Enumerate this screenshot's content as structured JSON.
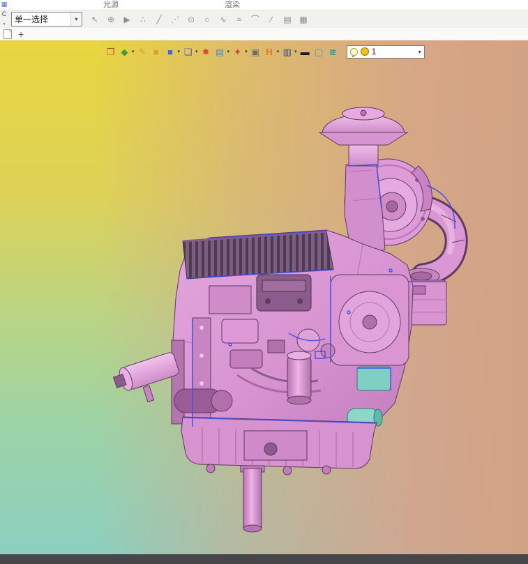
{
  "ribbon": {
    "group_labels": [
      "光源",
      "渲染"
    ]
  },
  "edge_icons": [
    {
      "name": "window-grid-icon",
      "glyph": "▦",
      "color": "#4a6fd0"
    },
    {
      "name": "clip-icon",
      "glyph": "C",
      "color": "#444444"
    },
    {
      "name": "pin-icon",
      "glyph": "▪",
      "color": "#888888"
    }
  ],
  "selection_toolbar": {
    "mode_value": "单一选择",
    "icons": [
      {
        "name": "select-cursor-icon",
        "glyph": "↖"
      },
      {
        "name": "rotate-select-icon",
        "glyph": "⊕"
      },
      {
        "name": "play-icon",
        "glyph": "▶"
      },
      {
        "name": "point-snap-icon",
        "glyph": "∴"
      },
      {
        "name": "line-icon",
        "glyph": "╱"
      },
      {
        "name": "polyline-icon",
        "glyph": "⋰"
      },
      {
        "name": "circle-point-icon",
        "glyph": "⊙"
      },
      {
        "name": "circle-icon",
        "glyph": "○"
      },
      {
        "name": "spline-icon",
        "glyph": "∿"
      },
      {
        "name": "wave-curve-icon",
        "glyph": "≈"
      },
      {
        "name": "arc-icon",
        "glyph": "⌒"
      },
      {
        "name": "segment-icon",
        "glyph": "∕"
      },
      {
        "name": "sheet-icon",
        "glyph": "▤"
      },
      {
        "name": "layers-sheet-icon",
        "glyph": "▦"
      }
    ]
  },
  "tab_bar": {
    "new_tab": "+"
  },
  "render_toolbar": {
    "icons": [
      {
        "name": "render-window-icon",
        "glyph": "❐",
        "color": "#b04a3a"
      },
      {
        "name": "material-apply-icon",
        "glyph": "◆",
        "color": "#3f9b3f",
        "dropdown": true
      },
      {
        "name": "paintbrush-icon",
        "glyph": "✎",
        "color": "#c9a227"
      },
      {
        "name": "cube-yellow-icon",
        "glyph": "■",
        "color": "#d8a427"
      },
      {
        "name": "cube-blue-icon",
        "glyph": "■",
        "color": "#3f6fd8",
        "dropdown": true
      },
      {
        "name": "cube-stack-icon",
        "glyph": "❏",
        "color": "#5a4fd8",
        "dropdown": true
      },
      {
        "name": "material-ball-icon",
        "glyph": "✹",
        "color": "#d84a2f"
      },
      {
        "name": "texture-image-icon",
        "glyph": "▤",
        "color": "#3f8fd8",
        "dropdown": true
      },
      {
        "name": "light-direction-icon",
        "glyph": "✦",
        "color": "#d83a3a",
        "dropdown": true
      },
      {
        "name": "viewport-frame-icon",
        "glyph": "▣",
        "color": "#6b6b6b"
      },
      {
        "name": "hdr-icon",
        "glyph": "H",
        "color": "#e07b1f",
        "dropdown": true
      },
      {
        "name": "monitor-icon",
        "glyph": "▥",
        "color": "#2f4a8f",
        "dropdown": true
      },
      {
        "name": "exposure-bar-icon",
        "glyph": "▬",
        "color": "#1a1a1a"
      },
      {
        "name": "ground-plane-icon",
        "glyph": "▢",
        "color": "#4aa0a0"
      },
      {
        "name": "layers-teal-icon",
        "glyph": "≋",
        "color": "#2f8f8f"
      }
    ],
    "light_count": "1"
  },
  "ui": {
    "caret": "▾"
  },
  "viewport": {
    "model_name": "engine-3d-model",
    "colors": {
      "model_pink": "#dd9ad7",
      "model_light": "#f0bcea",
      "model_dark": "#a868a2",
      "outline": "#5f3a5e",
      "edge_highlight_blue": "#3c4fe0",
      "accent_teal": "#7fd0c2",
      "bg_yellow": "#e8d53e",
      "bg_green": "#8ccfc0",
      "bg_tan": "#d2a284"
    }
  }
}
